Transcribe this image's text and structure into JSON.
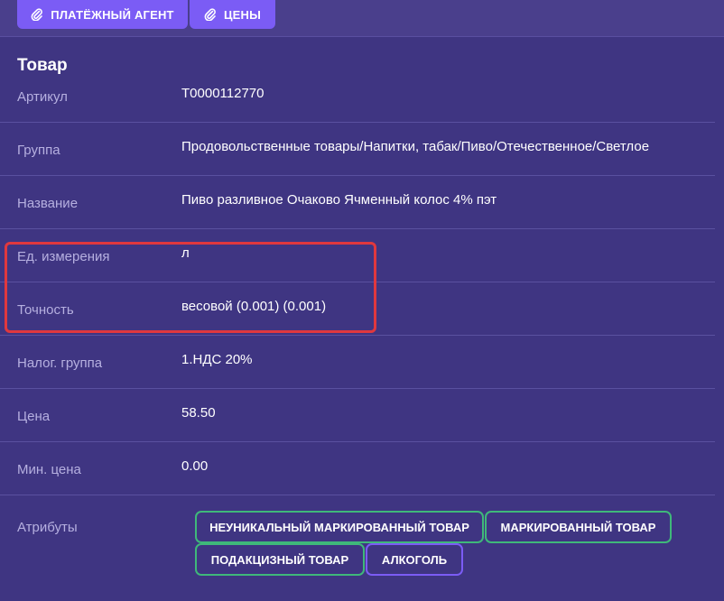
{
  "tabs": [
    {
      "label": "ПЛАТЁЖНЫЙ АГЕНТ",
      "icon": "paperclip-icon"
    },
    {
      "label": "ЦЕНЫ",
      "icon": "paperclip-icon"
    }
  ],
  "section": {
    "title": "Товар"
  },
  "fields": [
    {
      "label": "Артикул",
      "value": "Т0000112770"
    },
    {
      "label": "Группа",
      "value": "Продовольственные товары/Напитки, табак/Пиво/Отечественное/Светлое"
    },
    {
      "label": "Название",
      "value": "Пиво разливное Очаково Ячменный колос 4% пэт"
    },
    {
      "label": "Ед. измерения",
      "value": "л"
    },
    {
      "label": "Точность",
      "value": "весовой (0.001) (0.001)"
    },
    {
      "label": "Налог. группа",
      "value": "1.НДС 20%"
    },
    {
      "label": "Цена",
      "value": "58.50"
    },
    {
      "label": "Мин. цена",
      "value": "0.00"
    }
  ],
  "attributes": {
    "label": "Атрибуты",
    "chips": [
      {
        "label": "НЕУНИКАЛЬНЫЙ МАРКИРОВАННЫЙ ТОВАР",
        "color": "#3fb87a"
      },
      {
        "label": "МАРКИРОВАННЫЙ ТОВАР",
        "color": "#3fb87a"
      },
      {
        "label": "ПОДАКЦИЗНЫЙ ТОВАР",
        "color": "#3fb87a"
      },
      {
        "label": "АЛКОГОЛЬ",
        "color": "#7b5cf5"
      }
    ]
  },
  "colors": {
    "background": "#3f3582",
    "accent": "#7b5cf5",
    "highlight": "#e0383e"
  }
}
